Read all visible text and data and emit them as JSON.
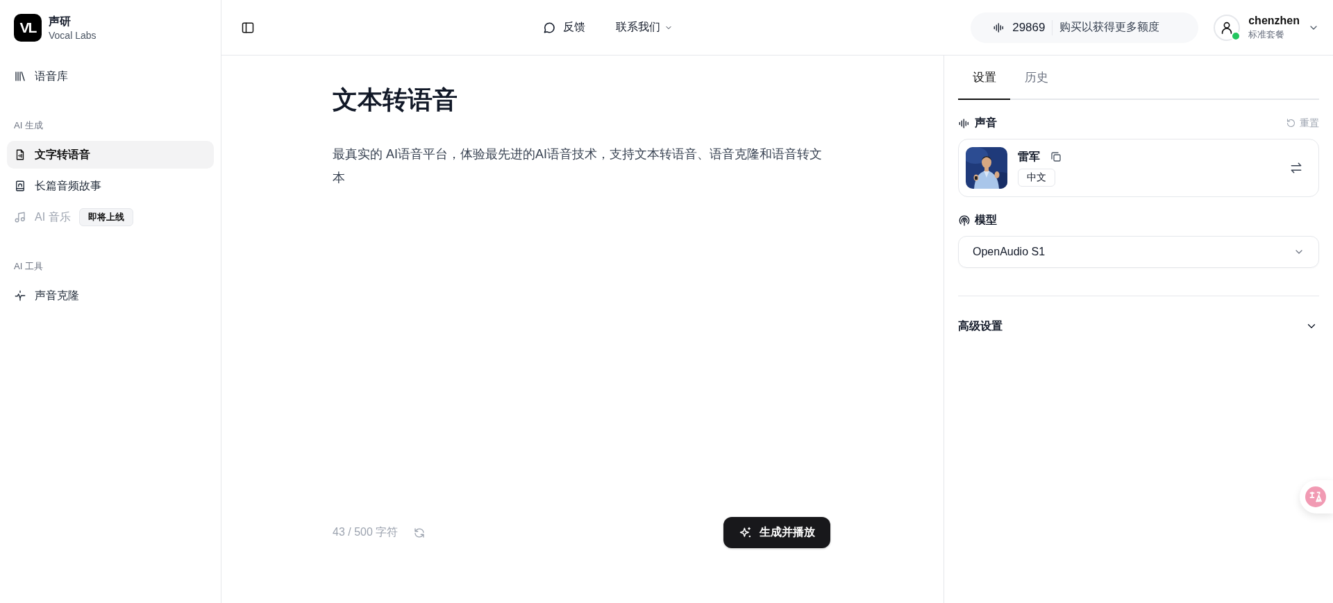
{
  "sidebar": {
    "brand": {
      "logo": "VL",
      "name": "声研",
      "subtitle": "Vocal Labs"
    },
    "items": [
      {
        "label": "语音库",
        "kind": "library",
        "selected": false,
        "disabled": false
      }
    ],
    "sections": [
      {
        "title": "AI 生成",
        "items": [
          {
            "label": "文字转语音",
            "kind": "document",
            "selected": true,
            "disabled": false
          },
          {
            "label": "长篇音频故事",
            "kind": "book",
            "selected": false,
            "disabled": false
          },
          {
            "label": "AI 音乐",
            "kind": "music",
            "selected": false,
            "disabled": true,
            "badge": "即将上线"
          }
        ]
      },
      {
        "title": "AI 工具",
        "items": [
          {
            "label": "声音克隆",
            "kind": "clone",
            "selected": false,
            "disabled": false
          }
        ]
      }
    ]
  },
  "top_bar": {
    "links": [
      {
        "label": "反馈",
        "kind": "feedback"
      },
      {
        "label": "联系我们",
        "kind": "dropdown"
      }
    ],
    "credits": {
      "count": "29869",
      "action": "购买以获得更多额度"
    },
    "user": {
      "name": "chenzhen",
      "plan": "标准套餐",
      "online": true
    }
  },
  "main": {
    "title": "文本转语音",
    "text": "最真实的 AI语音平台，体验最先进的AI语音技术，支持文本转语音、语音克隆和语音转文本",
    "counter": "43 / 500 字符",
    "generate_button": "生成并播放"
  },
  "settings_panel": {
    "tabs": [
      {
        "label": "设置",
        "selected": true
      },
      {
        "label": "历史",
        "selected": false
      }
    ],
    "voice": {
      "heading": "声音",
      "reset": "重置",
      "name": "雷军",
      "language": "中文"
    },
    "model": {
      "heading": "模型",
      "value": "OpenAudio S1"
    },
    "advanced": {
      "heading": "高级设置",
      "expanded": false
    }
  }
}
